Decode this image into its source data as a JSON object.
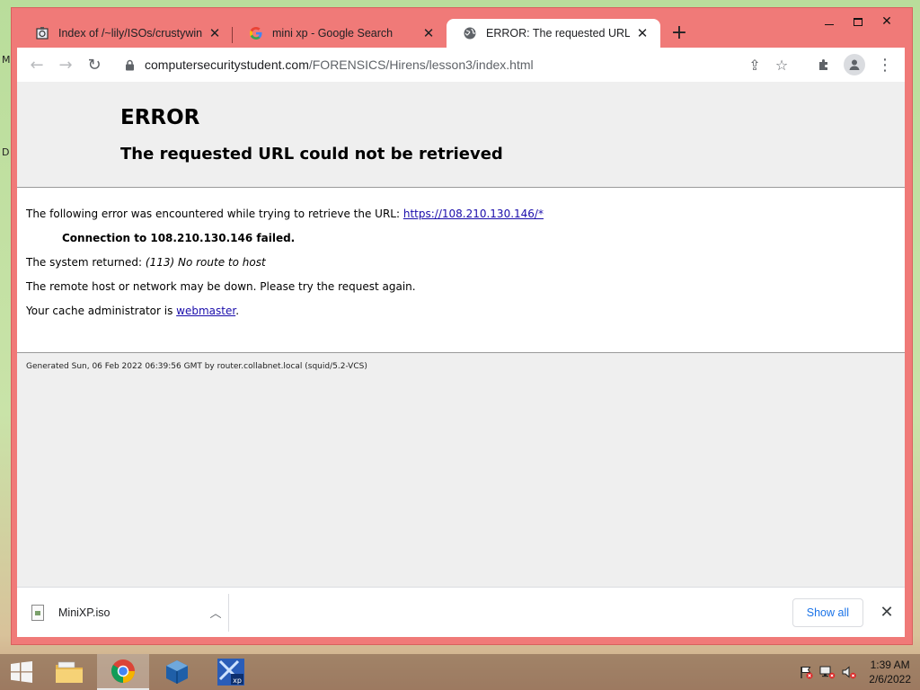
{
  "desktop": {
    "marks": [
      "M",
      "D"
    ]
  },
  "window": {
    "controls": {
      "minimize": "minimize",
      "maximize": "maximize",
      "close": "✕"
    }
  },
  "tabs": [
    {
      "title": "Index of /~lily/ISOs/crustywindo",
      "close": "✕",
      "icon": "package-icon"
    },
    {
      "title": "mini xp - Google Search",
      "close": "✕",
      "icon": "google-icon"
    },
    {
      "title": "ERROR: The requested URL could",
      "close": "✕",
      "icon": "globe-icon",
      "active": true
    }
  ],
  "new_tab_label": "+",
  "toolbar": {
    "back": "←",
    "forward": "→",
    "reload": "↻",
    "url_host": "computersecuritystudent.com",
    "url_path": "/FORENSICS/Hirens/lesson3/index.html",
    "share": "⇪",
    "bookmark": "☆",
    "menu": "⋮"
  },
  "page": {
    "title": "ERROR",
    "subtitle": "The requested URL could not be retrieved",
    "line1_prefix": "The following error was encountered while trying to retrieve the URL: ",
    "line1_link": "https://108.210.130.146/*",
    "line2": "Connection to 108.210.130.146 failed.",
    "line3_prefix": "The system returned: ",
    "line3_italic": "(113) No route to host",
    "line4": "The remote host or network may be down. Please try the request again.",
    "line5_prefix": "Your cache administrator is ",
    "line5_link": "webmaster",
    "line5_suffix": ".",
    "footer": "Generated Sun, 06 Feb 2022 06:39:56 GMT by router.collabnet.local (squid/5.2-VCS)"
  },
  "downloads": {
    "item_name": "MiniXP.iso",
    "caret": "︿",
    "show_all": "Show all",
    "close": "✕"
  },
  "taskbar": {
    "apps": [
      "file-explorer-icon",
      "chrome-icon",
      "virtualbox-icon",
      "mini-xp-icon"
    ],
    "time": "1:39 AM",
    "date": "2/6/2022"
  },
  "colors": {
    "window_frame": "#f07a78",
    "link": "#1a0dab",
    "show_all": "#1a73e8"
  }
}
